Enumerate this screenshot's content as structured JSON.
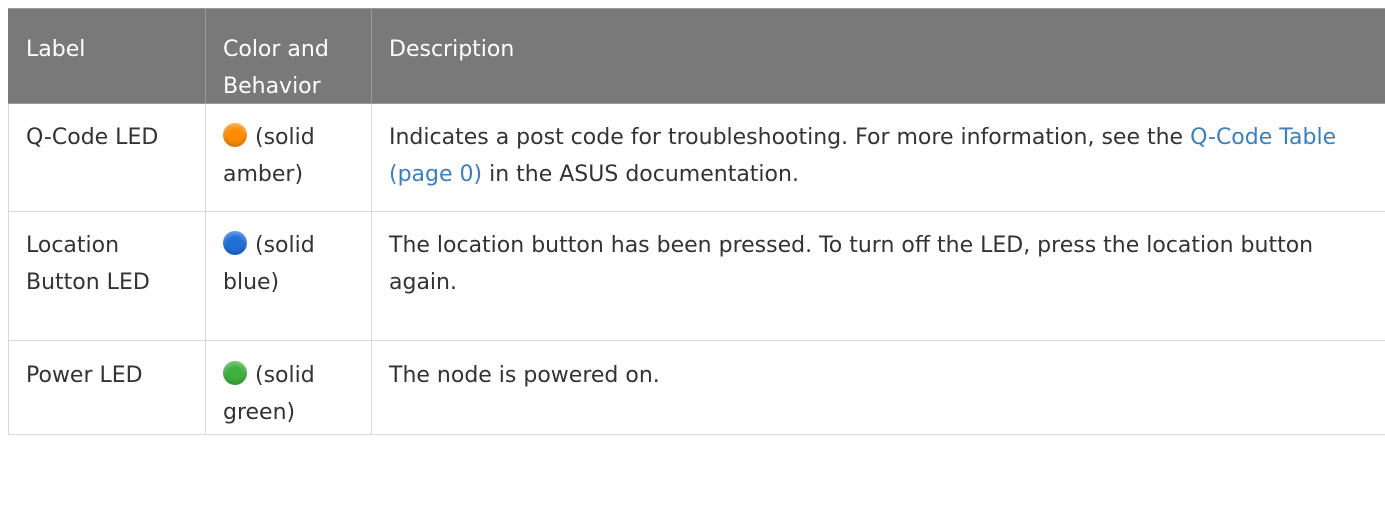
{
  "table": {
    "headers": [
      "Label",
      "Color and Behavior",
      "Description"
    ],
    "rows": [
      {
        "label": "Q-Code LED",
        "color_name": "amber",
        "color_hex": "#ff8c00",
        "behavior": "(solid amber)",
        "description_before": "Indicates a post code for troubleshooting. For more information, see the ",
        "link_text": "Q-Code Table (page 0)",
        "description_after": " in the ASUS documentation."
      },
      {
        "label": "Location Button LED",
        "color_name": "blue",
        "color_hex": "#1f6fd6",
        "behavior": "(solid blue)",
        "description": "The location button has been pressed. To turn off the LED, press the location button again."
      },
      {
        "label": "Power LED",
        "color_name": "green",
        "color_hex": "#3fb040",
        "behavior": "(solid green)",
        "description": "The node is powered on."
      }
    ]
  },
  "colors": {
    "header_bg": "#797979",
    "header_text": "#ffffff",
    "link": "#3d7fb9",
    "border": "#d9d9d9"
  }
}
